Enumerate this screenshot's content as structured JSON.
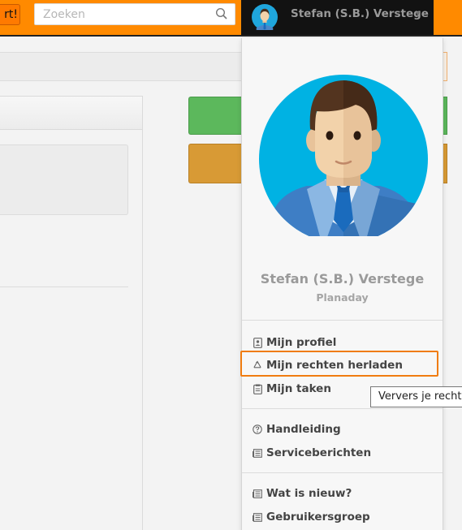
{
  "topbar": {
    "start_label": "rt!",
    "search_placeholder": "Zoeken",
    "user_name": "Stefan (S.B.) Verstege",
    "caret": "▾"
  },
  "dropdown": {
    "full_name": "Stefan (S.B.) Verstege",
    "organization": "Planaday",
    "items": [
      {
        "label": "Mijn profiel",
        "icon": "profile-icon"
      },
      {
        "label": "Mijn rechten herladen",
        "icon": "recycle-icon"
      },
      {
        "label": "Mijn taken",
        "icon": "clipboard-icon"
      },
      {
        "label": "Handleiding",
        "icon": "help-icon"
      },
      {
        "label": "Serviceberichten",
        "icon": "news-icon"
      },
      {
        "label": "Wat is nieuw?",
        "icon": "news-icon"
      },
      {
        "label": "Gebruikersgroep",
        "icon": "news-icon"
      }
    ]
  },
  "tooltip": {
    "text": "Ververs je rechten"
  },
  "colors": {
    "brand_orange": "#ff8a00",
    "highlight": "#f07c10",
    "success": "#5cb85c",
    "warning": "#d89a35"
  }
}
